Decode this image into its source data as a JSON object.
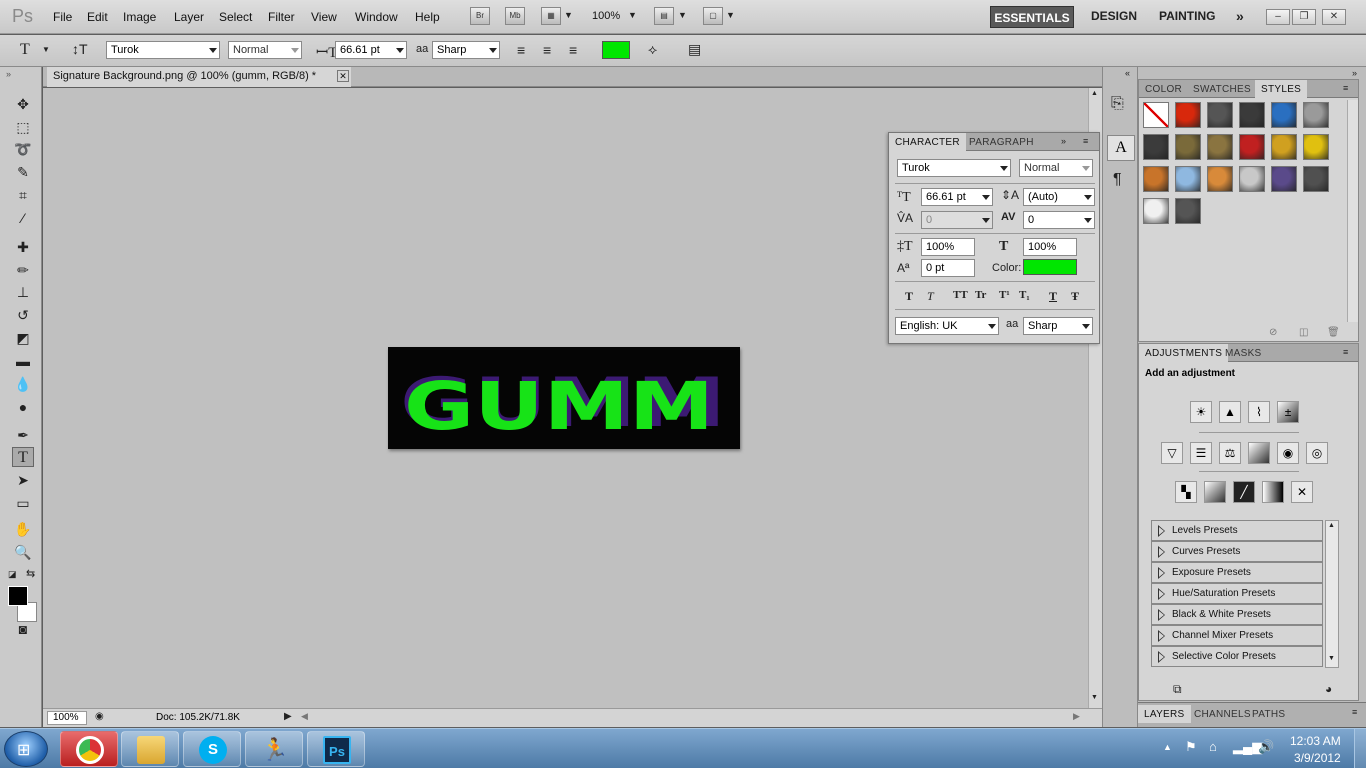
{
  "app": {
    "logo": "Ps"
  },
  "menu": [
    "File",
    "Edit",
    "Image",
    "Layer",
    "Select",
    "Filter",
    "View",
    "Window",
    "Help"
  ],
  "appbar": {
    "bridge": "Br",
    "minibridge": "Mb",
    "zoom": "100%"
  },
  "workspaces": [
    "ESSENTIALS",
    "DESIGN",
    "PAINTING"
  ],
  "options": {
    "font_family": "Turok",
    "font_style": "Normal",
    "font_size": "66.61 pt",
    "antialias_icon": "aa",
    "antialias": "Sharp",
    "text_color": "#00e600"
  },
  "document": {
    "tab_title": "Signature Background.png @ 100% (gumm, RGB/8) *",
    "zoom": "100%",
    "doc_info": "Doc: 105.2K/71.8K",
    "image_text": "GUMM",
    "text_fill": "#17e317",
    "shadow_fill": "#3c1a73"
  },
  "character": {
    "tabs": [
      "CHARACTER",
      "PARAGRAPH"
    ],
    "font_family": "Turok",
    "font_style": "Normal",
    "size": "66.61 pt",
    "leading": "(Auto)",
    "kerning": "0",
    "tracking": "0",
    "vscale": "100%",
    "hscale": "100%",
    "baseline": "0 pt",
    "color_label": "Color:",
    "color": "#00e600",
    "language": "English: UK",
    "antialias": "Sharp",
    "style_buttons": [
      "T",
      "T",
      "TT",
      "Tr",
      "T¹",
      "T₁",
      "T",
      "Ŧ"
    ]
  },
  "styles_panel": {
    "tabs": [
      "COLOR",
      "SWATCHES",
      "STYLES"
    ],
    "swatch_colors": [
      "#ffffff",
      "#d8280c",
      "#555555",
      "#3a3a3a",
      "#2a6fc0",
      "#9a9a9a",
      "#3b3b3b",
      "#7a6a3a",
      "#8a7440",
      "#c02020",
      "#d0a020",
      "#e0c010",
      "#c8742a",
      "#8fb8e0",
      "#d88a3a",
      "#c8c8c8",
      "#5a4a8a",
      "#505050",
      "#f0f0f0",
      "#555555"
    ]
  },
  "adjustments": {
    "tabs": [
      "ADJUSTMENTS",
      "MASKS"
    ],
    "heading": "Add an adjustment",
    "presets": [
      "Levels Presets",
      "Curves Presets",
      "Exposure Presets",
      "Hue/Saturation Presets",
      "Black & White Presets",
      "Channel Mixer Presets",
      "Selective Color Presets"
    ]
  },
  "layers_panel": {
    "tabs": [
      "LAYERS",
      "CHANNELS",
      "PATHS"
    ]
  },
  "taskbar": {
    "apps": [
      "chrome",
      "explorer",
      "skype",
      "aim",
      "Ps"
    ],
    "time": "12:03 AM",
    "date": "3/9/2012"
  }
}
